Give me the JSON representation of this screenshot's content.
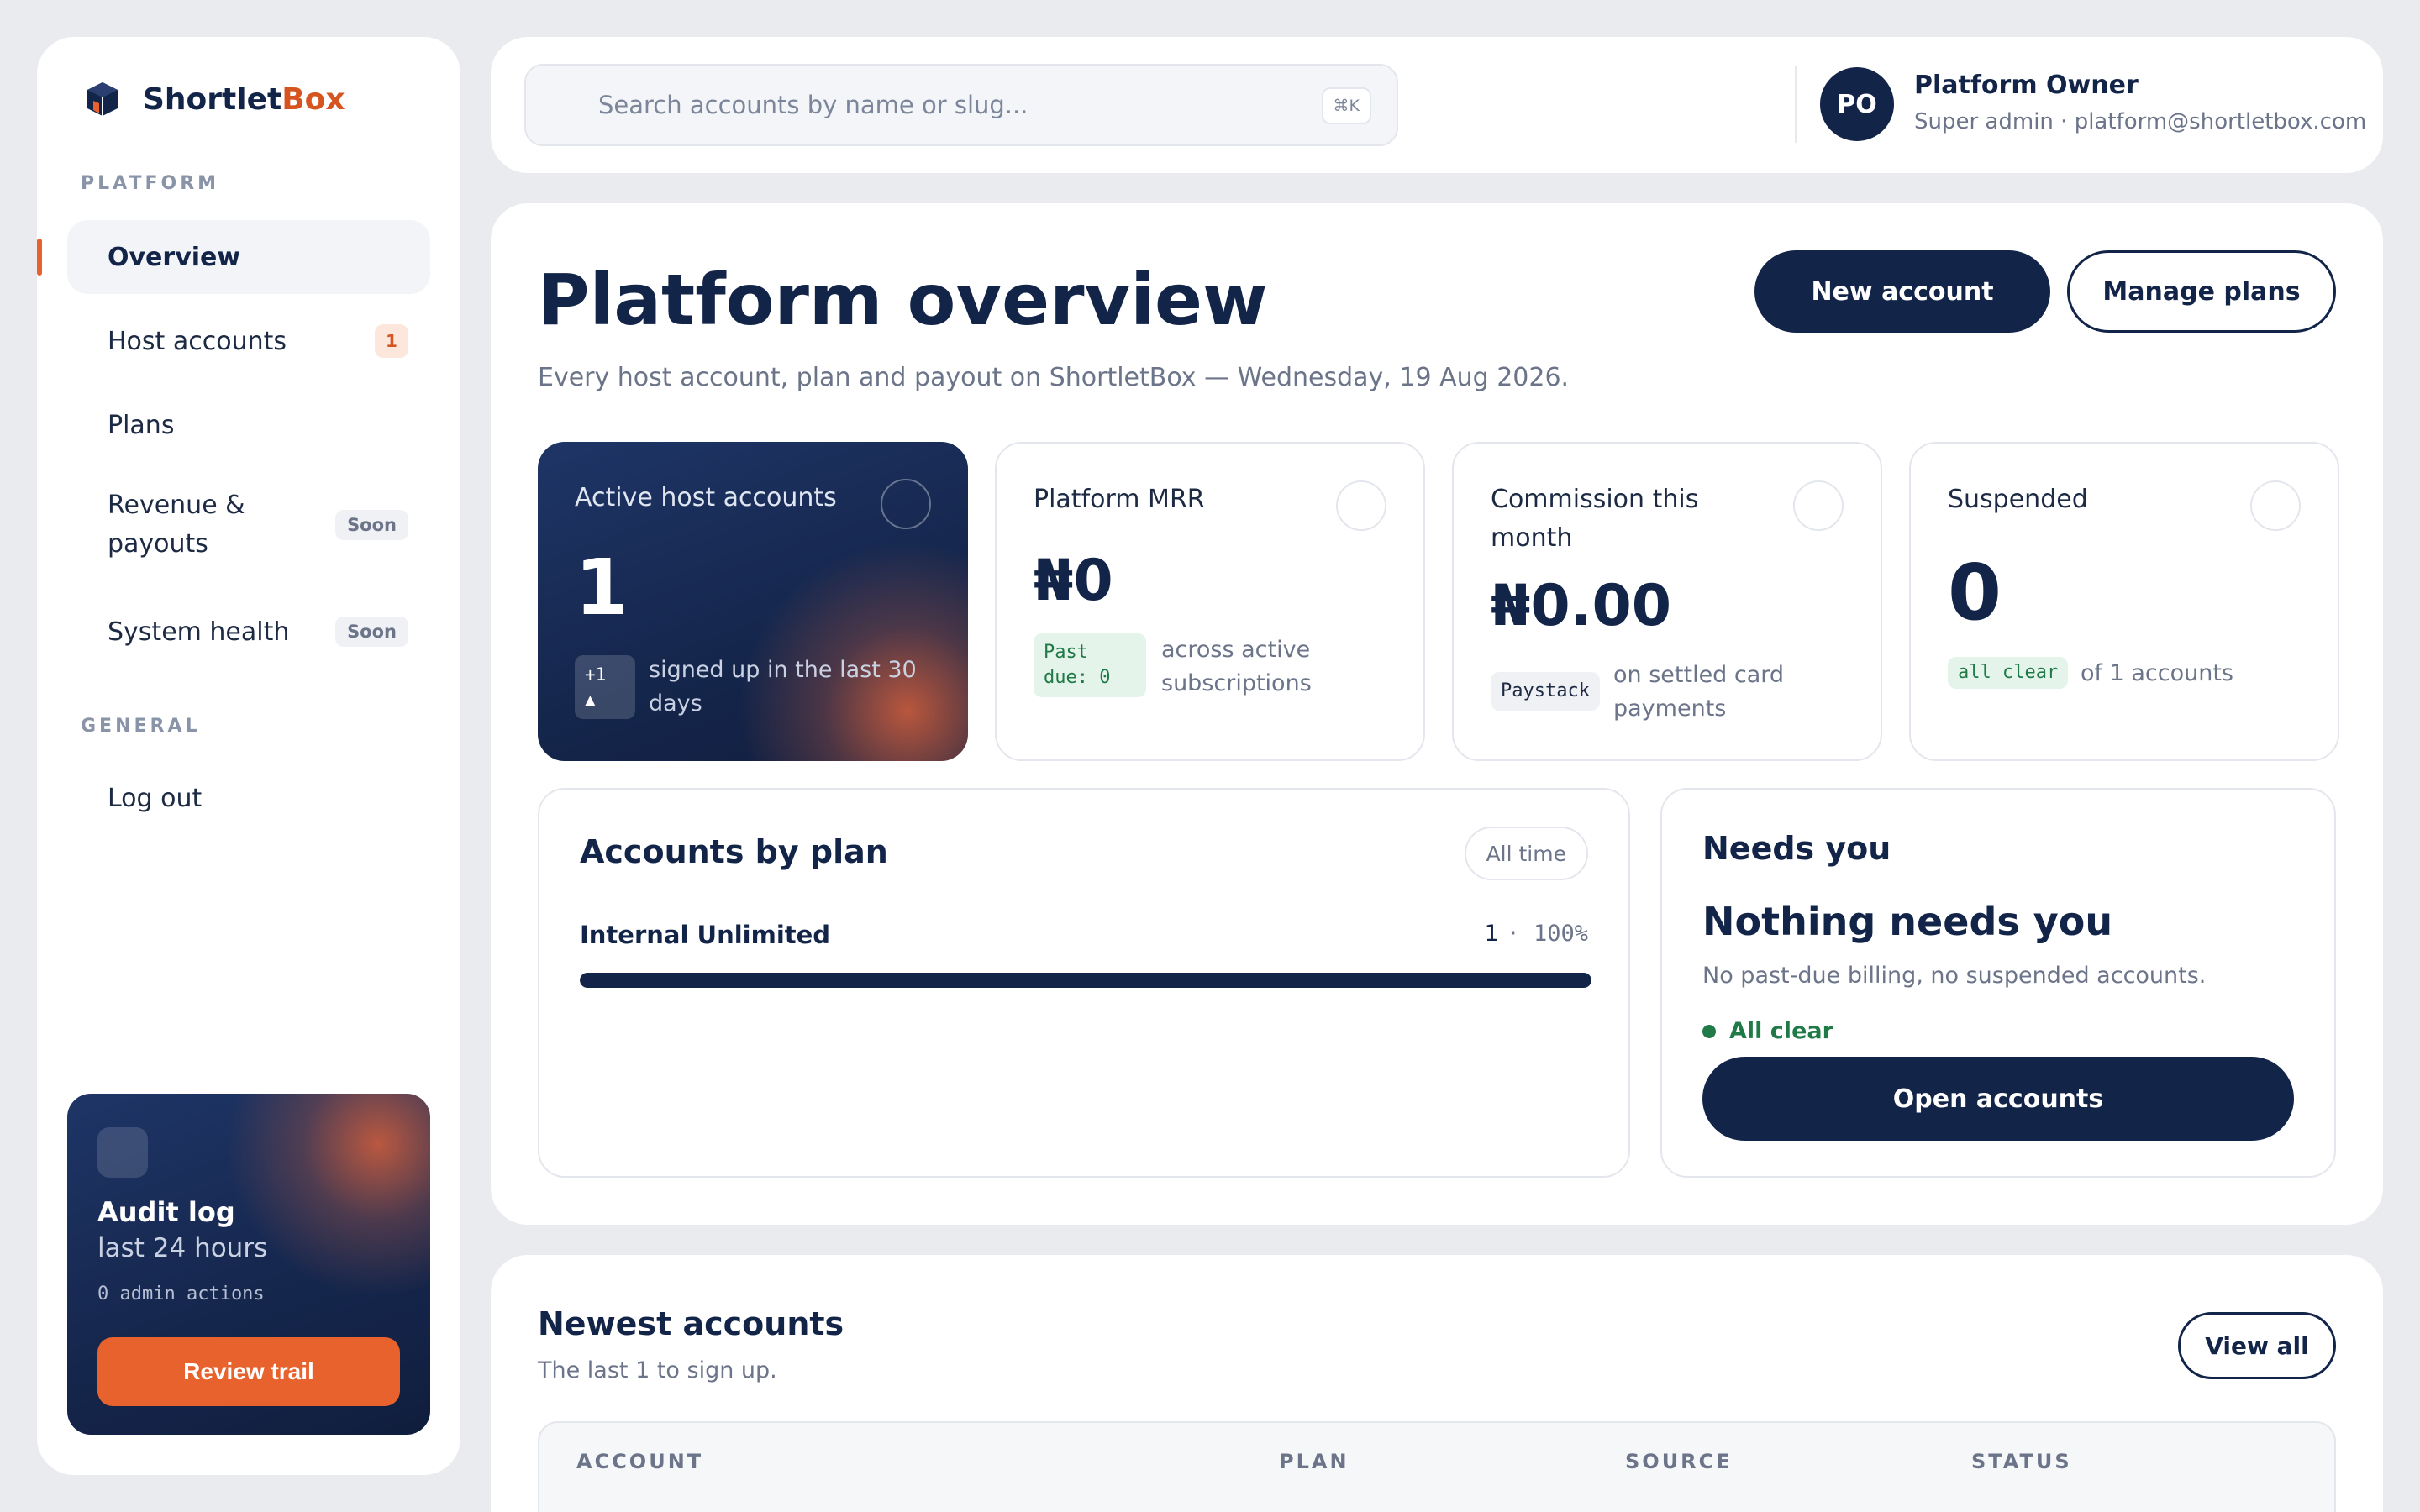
{
  "brand": {
    "name_part1": "Shortlet",
    "name_part2": "Box",
    "accent": "#d5541f",
    "primary": "#132449"
  },
  "sidebar": {
    "section_platform": "PLATFORM",
    "section_general": "GENERAL",
    "items": [
      {
        "label": "Overview",
        "active": true
      },
      {
        "label": "Host accounts",
        "badge": "1"
      },
      {
        "label": "Plans"
      },
      {
        "label": "Revenue & payouts",
        "badge": "Soon"
      },
      {
        "label": "System health",
        "badge": "Soon"
      }
    ],
    "logout": "Log out",
    "audit": {
      "title": "Audit log",
      "subtitle": "last 24 hours",
      "meta": "0 admin actions",
      "button": "Review trail"
    }
  },
  "topbar": {
    "search_placeholder": "Search accounts by name or slug...",
    "search_shortcut": "⌘K",
    "user_initials": "PO",
    "user_name": "Platform Owner",
    "user_sub": "Super admin · platform@shortletbox.com"
  },
  "main": {
    "title": "Platform overview",
    "subtitle": "Every host account, plan and payout on ShortletBox — Wednesday, 19 Aug 2026.",
    "new_account": "New account",
    "manage_plans": "Manage plans",
    "stats": [
      {
        "label": "Active host accounts",
        "value": "1",
        "chip": "+1 ▲",
        "note": "signed up in the last 30 days"
      },
      {
        "label": "Platform MRR",
        "value": "₦0",
        "chip": "Past due: 0",
        "note": "across active subscriptions"
      },
      {
        "label": "Commission this month",
        "value": "₦0.00",
        "chip": "Paystack",
        "note": "on settled card payments"
      },
      {
        "label": "Suspended",
        "value": "0",
        "chip": "all clear",
        "note": "of 1 accounts"
      }
    ],
    "accounts_by_plan": {
      "title": "Accounts by plan",
      "range": "All time",
      "plans": [
        {
          "name": "Internal Unlimited",
          "count": "1",
          "percent": "100%",
          "fraction": 1.0
        }
      ]
    },
    "needs_you": {
      "title": "Needs you",
      "headline": "Nothing needs you",
      "sub": "No past-due billing, no suspended accounts.",
      "status": "All clear",
      "button": "Open accounts"
    }
  },
  "newest": {
    "title": "Newest accounts",
    "sub": "The last 1 to sign up.",
    "view_all": "View all",
    "columns": [
      "ACCOUNT",
      "PLAN",
      "SOURCE",
      "STATUS"
    ]
  }
}
